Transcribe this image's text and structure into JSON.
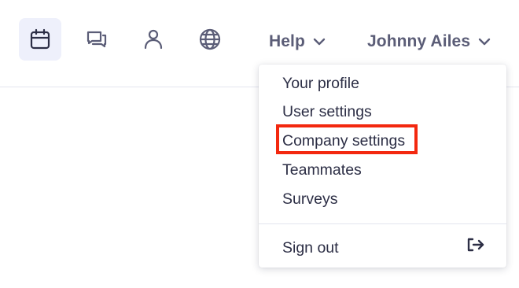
{
  "topbar": {
    "icons": [
      {
        "name": "calendar-icon",
        "active": true
      },
      {
        "name": "chat-icon",
        "active": false
      },
      {
        "name": "user-icon",
        "active": false
      },
      {
        "name": "globe-icon",
        "active": false
      }
    ],
    "help_label": "Help",
    "user_label": "Johnny Ailes"
  },
  "dropdown": {
    "items": [
      {
        "label": "Your profile"
      },
      {
        "label": "User settings"
      },
      {
        "label": "Company settings"
      },
      {
        "label": "Teammates"
      },
      {
        "label": "Surveys"
      }
    ],
    "signout_label": "Sign out"
  },
  "colors": {
    "icon": "#2c2e45",
    "menu_text": "#5b5d77",
    "active_bg": "#eef0fb",
    "highlight": "#f3280f"
  }
}
